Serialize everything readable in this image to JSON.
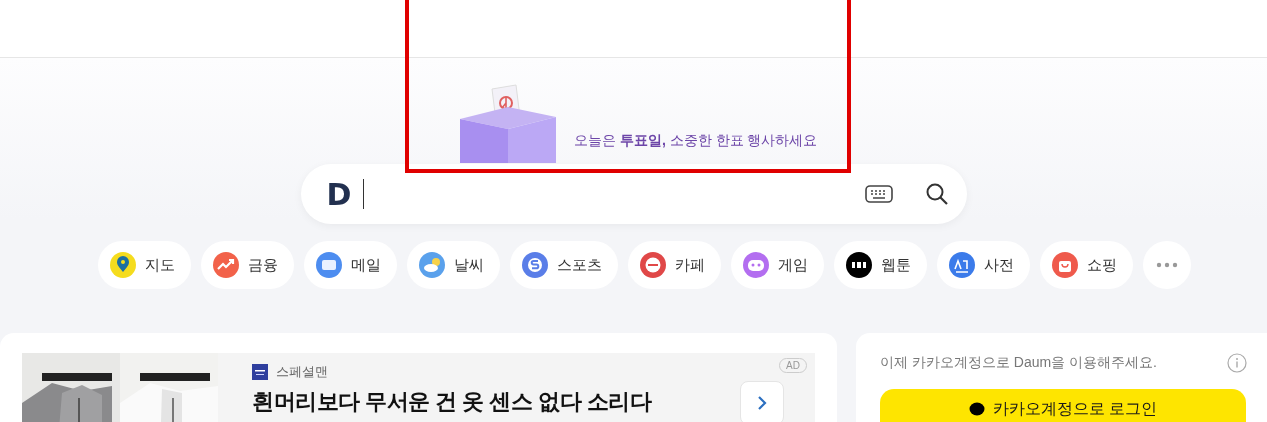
{
  "banner": {
    "message": "오늘은 **투표일,** 소중한 한표 행사하세요"
  },
  "search": {
    "logo": "D"
  },
  "shortcuts": [
    {
      "kind": "map",
      "label": "지도"
    },
    {
      "kind": "finance",
      "label": "금융"
    },
    {
      "kind": "mail",
      "label": "메일"
    },
    {
      "kind": "weather",
      "label": "날씨"
    },
    {
      "kind": "sports",
      "label": "스포츠"
    },
    {
      "kind": "cafe",
      "label": "카페"
    },
    {
      "kind": "game",
      "label": "게임"
    },
    {
      "kind": "webtoon",
      "label": "웹툰"
    },
    {
      "kind": "dict",
      "label": "사전"
    },
    {
      "kind": "shop",
      "label": "쇼핑"
    },
    {
      "kind": "more"
    }
  ],
  "ad": {
    "kind": "picture",
    "advertiser": "스페셜맨",
    "badge": "AD",
    "headline": "흰머리보다 무서운 건 옷 센스 없다 소리다"
  },
  "login": {
    "notice": "이제 카카오계정으로 Daum을 이용해주세요.",
    "button": "카카오계정으로 로그인"
  }
}
